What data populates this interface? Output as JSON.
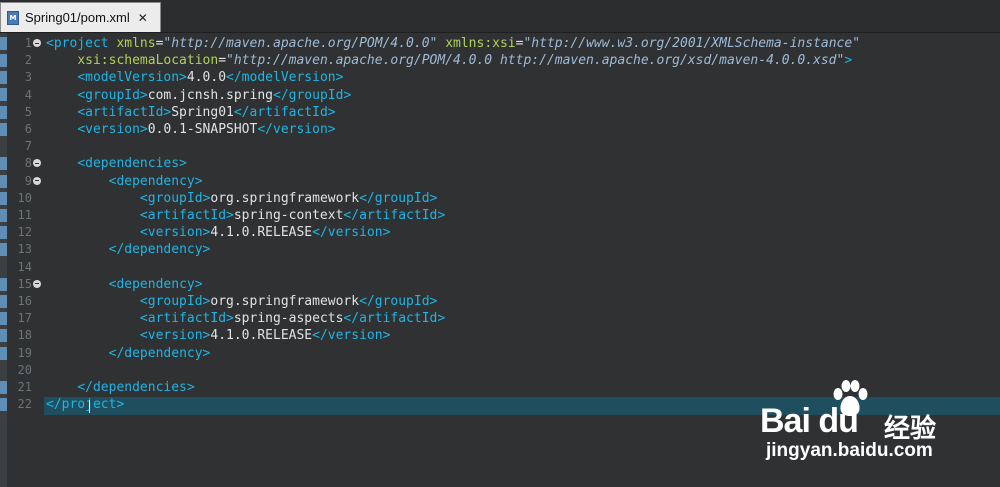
{
  "tab": {
    "label": "Spring01/pom.xml",
    "close": "✕",
    "icon_text": "M"
  },
  "lines": [
    {
      "n": "1",
      "fold": true,
      "parts": [
        {
          "c": "tg",
          "t": "<project "
        },
        {
          "c": "at",
          "t": "xmlns"
        },
        {
          "c": "pl",
          "t": "="
        },
        {
          "c": "vl",
          "t": "\"http://maven.apache.org/POM/4.0.0\""
        },
        {
          "c": "pl",
          "t": " "
        },
        {
          "c": "at",
          "t": "xmlns:xsi"
        },
        {
          "c": "pl",
          "t": "="
        },
        {
          "c": "vl",
          "t": "\"http://www.w3.org/2001/XMLSchema-instance\""
        }
      ]
    },
    {
      "n": "2",
      "fold": false,
      "parts": [
        {
          "c": "pl",
          "t": "    "
        },
        {
          "c": "at",
          "t": "xsi:schemaLocation"
        },
        {
          "c": "pl",
          "t": "="
        },
        {
          "c": "vl",
          "t": "\"http://maven.apache.org/POM/4.0.0 http://maven.apache.org/xsd/maven-4.0.0.xsd\""
        },
        {
          "c": "tg",
          "t": ">"
        }
      ]
    },
    {
      "n": "3",
      "fold": false,
      "parts": [
        {
          "c": "pl",
          "t": "    "
        },
        {
          "c": "tg",
          "t": "<modelVersion>"
        },
        {
          "c": "pl",
          "t": "4.0.0"
        },
        {
          "c": "tg",
          "t": "</modelVersion>"
        }
      ]
    },
    {
      "n": "4",
      "fold": false,
      "parts": [
        {
          "c": "pl",
          "t": "    "
        },
        {
          "c": "tg",
          "t": "<groupId>"
        },
        {
          "c": "pl",
          "t": "com.jcnsh.spring"
        },
        {
          "c": "tg",
          "t": "</groupId>"
        }
      ]
    },
    {
      "n": "5",
      "fold": false,
      "parts": [
        {
          "c": "pl",
          "t": "    "
        },
        {
          "c": "tg",
          "t": "<artifactId>"
        },
        {
          "c": "pl",
          "t": "Spring01"
        },
        {
          "c": "tg",
          "t": "</artifactId>"
        }
      ]
    },
    {
      "n": "6",
      "fold": false,
      "parts": [
        {
          "c": "pl",
          "t": "    "
        },
        {
          "c": "tg",
          "t": "<version>"
        },
        {
          "c": "pl",
          "t": "0.0.1-SNAPSHOT"
        },
        {
          "c": "tg",
          "t": "</version>"
        }
      ]
    },
    {
      "n": "7",
      "fold": false,
      "parts": []
    },
    {
      "n": "8",
      "fold": true,
      "parts": [
        {
          "c": "pl",
          "t": "    "
        },
        {
          "c": "tg",
          "t": "<dependencies>"
        }
      ]
    },
    {
      "n": "9",
      "fold": true,
      "parts": [
        {
          "c": "pl",
          "t": "        "
        },
        {
          "c": "tg",
          "t": "<dependency>"
        }
      ]
    },
    {
      "n": "10",
      "fold": false,
      "parts": [
        {
          "c": "pl",
          "t": "            "
        },
        {
          "c": "tg",
          "t": "<groupId>"
        },
        {
          "c": "pl",
          "t": "org.springframework"
        },
        {
          "c": "tg",
          "t": "</groupId>"
        }
      ]
    },
    {
      "n": "11",
      "fold": false,
      "parts": [
        {
          "c": "pl",
          "t": "            "
        },
        {
          "c": "tg",
          "t": "<artifactId>"
        },
        {
          "c": "pl",
          "t": "spring-context"
        },
        {
          "c": "tg",
          "t": "</artifactId>"
        }
      ]
    },
    {
      "n": "12",
      "fold": false,
      "parts": [
        {
          "c": "pl",
          "t": "            "
        },
        {
          "c": "tg",
          "t": "<version>"
        },
        {
          "c": "pl",
          "t": "4.1.0.RELEASE"
        },
        {
          "c": "tg",
          "t": "</version>"
        }
      ]
    },
    {
      "n": "13",
      "fold": false,
      "parts": [
        {
          "c": "pl",
          "t": "        "
        },
        {
          "c": "tg",
          "t": "</dependency>"
        }
      ]
    },
    {
      "n": "14",
      "fold": false,
      "parts": []
    },
    {
      "n": "15",
      "fold": true,
      "parts": [
        {
          "c": "pl",
          "t": "        "
        },
        {
          "c": "tg",
          "t": "<dependency>"
        }
      ]
    },
    {
      "n": "16",
      "fold": false,
      "parts": [
        {
          "c": "pl",
          "t": "            "
        },
        {
          "c": "tg",
          "t": "<groupId>"
        },
        {
          "c": "pl",
          "t": "org.springframework"
        },
        {
          "c": "tg",
          "t": "</groupId>"
        }
      ]
    },
    {
      "n": "17",
      "fold": false,
      "parts": [
        {
          "c": "pl",
          "t": "            "
        },
        {
          "c": "tg",
          "t": "<artifactId>"
        },
        {
          "c": "pl",
          "t": "spring-aspects"
        },
        {
          "c": "tg",
          "t": "</artifactId>"
        }
      ]
    },
    {
      "n": "18",
      "fold": false,
      "parts": [
        {
          "c": "pl",
          "t": "            "
        },
        {
          "c": "tg",
          "t": "<version>"
        },
        {
          "c": "pl",
          "t": "4.1.0.RELEASE"
        },
        {
          "c": "tg",
          "t": "</version>"
        }
      ]
    },
    {
      "n": "19",
      "fold": false,
      "parts": [
        {
          "c": "pl",
          "t": "        "
        },
        {
          "c": "tg",
          "t": "</dependency>"
        }
      ]
    },
    {
      "n": "20",
      "fold": false,
      "parts": []
    },
    {
      "n": "21",
      "fold": false,
      "parts": [
        {
          "c": "pl",
          "t": "    "
        },
        {
          "c": "tg",
          "t": "</dependencies>"
        }
      ]
    },
    {
      "n": "22",
      "fold": false,
      "parts": [
        {
          "c": "tg",
          "t": "</project>"
        }
      ]
    }
  ],
  "current_line": "22",
  "watermark": {
    "brand": "Bai du",
    "cn": "经验",
    "url": "jingyan.baidu.com"
  }
}
